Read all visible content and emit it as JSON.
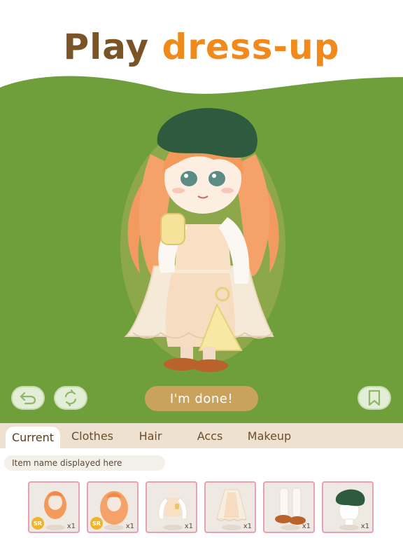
{
  "header": {
    "headline_part1": "Play",
    "headline_part2": "dress-up"
  },
  "colors": {
    "stage_green": "#6f9f3a",
    "headline_brown": "#7a5426",
    "headline_orange": "#f08a1c",
    "done_button": "#c9a35e",
    "tab_bar": "#eee1cf",
    "slot_border": "#e7a0b4"
  },
  "actions": {
    "undo_icon": "undo-arrow-icon",
    "rotate_icon": "rotate-icon",
    "done_label": "I'm done!",
    "bookmark_icon": "bookmark-icon"
  },
  "tabs": [
    {
      "label": "Current",
      "active": true
    },
    {
      "label": "Clothes",
      "active": false
    },
    {
      "label": "Hair",
      "active": false
    },
    {
      "label": "Accs",
      "active": false
    },
    {
      "label": "Makeup",
      "active": false
    }
  ],
  "panel": {
    "item_name": "Item name displayed here"
  },
  "items": [
    {
      "name": "hair-straight-orange",
      "rarity": "SR",
      "count": "x1"
    },
    {
      "name": "hair-wavy-orange",
      "rarity": "SR",
      "count": "x1"
    },
    {
      "name": "top-white-blouse",
      "rarity": "",
      "count": "x1"
    },
    {
      "name": "skirt-lace",
      "rarity": "",
      "count": "x1"
    },
    {
      "name": "socks-shoes",
      "rarity": "",
      "count": "x1"
    },
    {
      "name": "beret-green",
      "rarity": "",
      "count": "x1"
    }
  ]
}
